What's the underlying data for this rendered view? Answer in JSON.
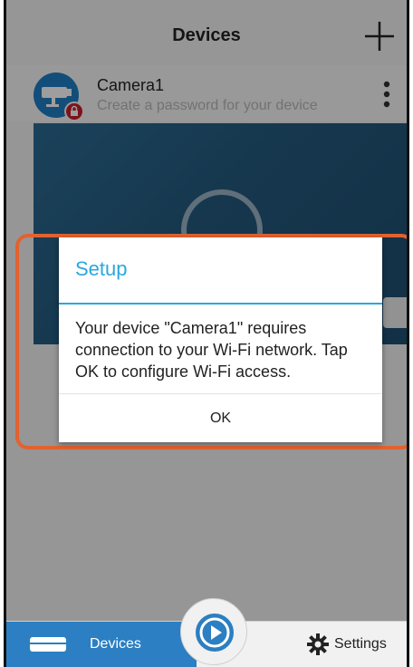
{
  "header": {
    "title": "Devices"
  },
  "device": {
    "name": "Camera1",
    "subtitle": "Create a password for your device"
  },
  "dialog": {
    "title": "Setup",
    "message": "Your device \"Camera1\" requires connection to your Wi-Fi network. Tap OK to configure Wi-Fi access.",
    "ok_label": "OK"
  },
  "bottom_nav": {
    "devices_label": "Devices",
    "settings_label": "Settings"
  },
  "colors": {
    "accent_blue": "#2b7fc2",
    "dialog_title": "#29a8df",
    "highlight": "#e2622f",
    "lock_badge": "#c8202a"
  },
  "icons": [
    "add-icon",
    "camera-avatar-icon",
    "lock-icon",
    "more-vert-icon",
    "play-icon",
    "gear-icon",
    "dvr-icon"
  ]
}
